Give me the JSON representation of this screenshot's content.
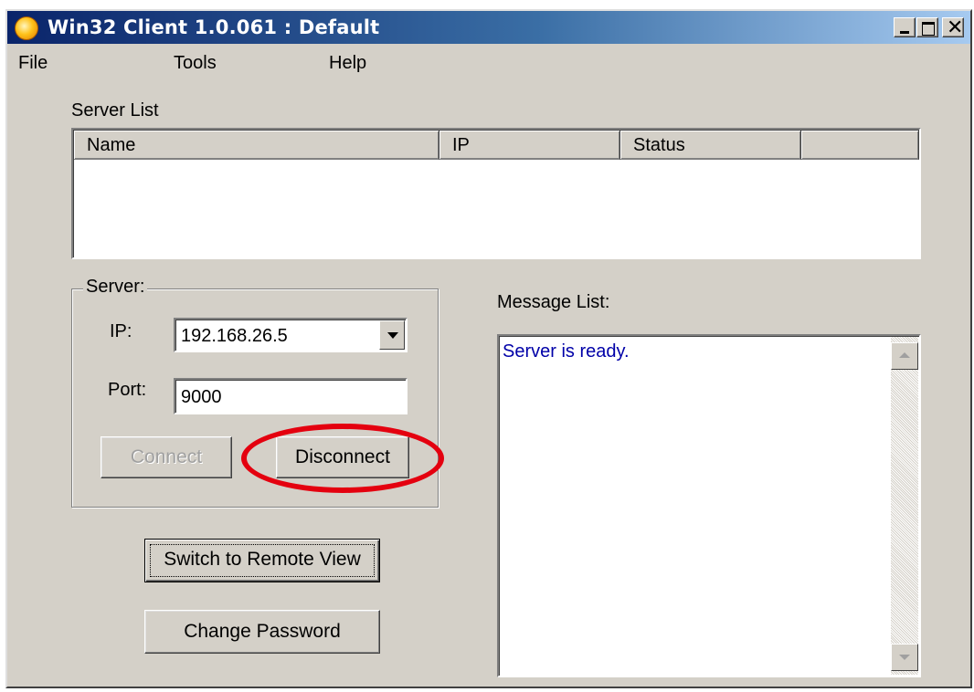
{
  "window": {
    "title": "Win32 Client 1.0.061 : Default",
    "caption_buttons": [
      "minimize-icon",
      "maximize-icon",
      "close-icon"
    ],
    "close_glyph": "✕"
  },
  "menu": {
    "items": [
      "File",
      "Tools",
      "Help"
    ]
  },
  "server_list": {
    "label": "Server List",
    "columns": [
      "Name",
      "IP",
      "Status"
    ],
    "rows": []
  },
  "server_group": {
    "caption": "Server:",
    "ip_label": "IP:",
    "ip_value": "192.168.26.5",
    "port_label": "Port:",
    "port_value": "9000",
    "connect_label": "Connect",
    "connect_enabled": false,
    "disconnect_label": "Disconnect"
  },
  "actions": {
    "remote_view_label": "Switch to Remote View",
    "change_password_label": "Change Password"
  },
  "message_list": {
    "label": "Message List:",
    "messages": [
      "Server is ready."
    ]
  },
  "colors": {
    "highlight_ellipse": "#e4000f",
    "message_text": "#0000a8",
    "window_face": "#d4d0c8"
  }
}
